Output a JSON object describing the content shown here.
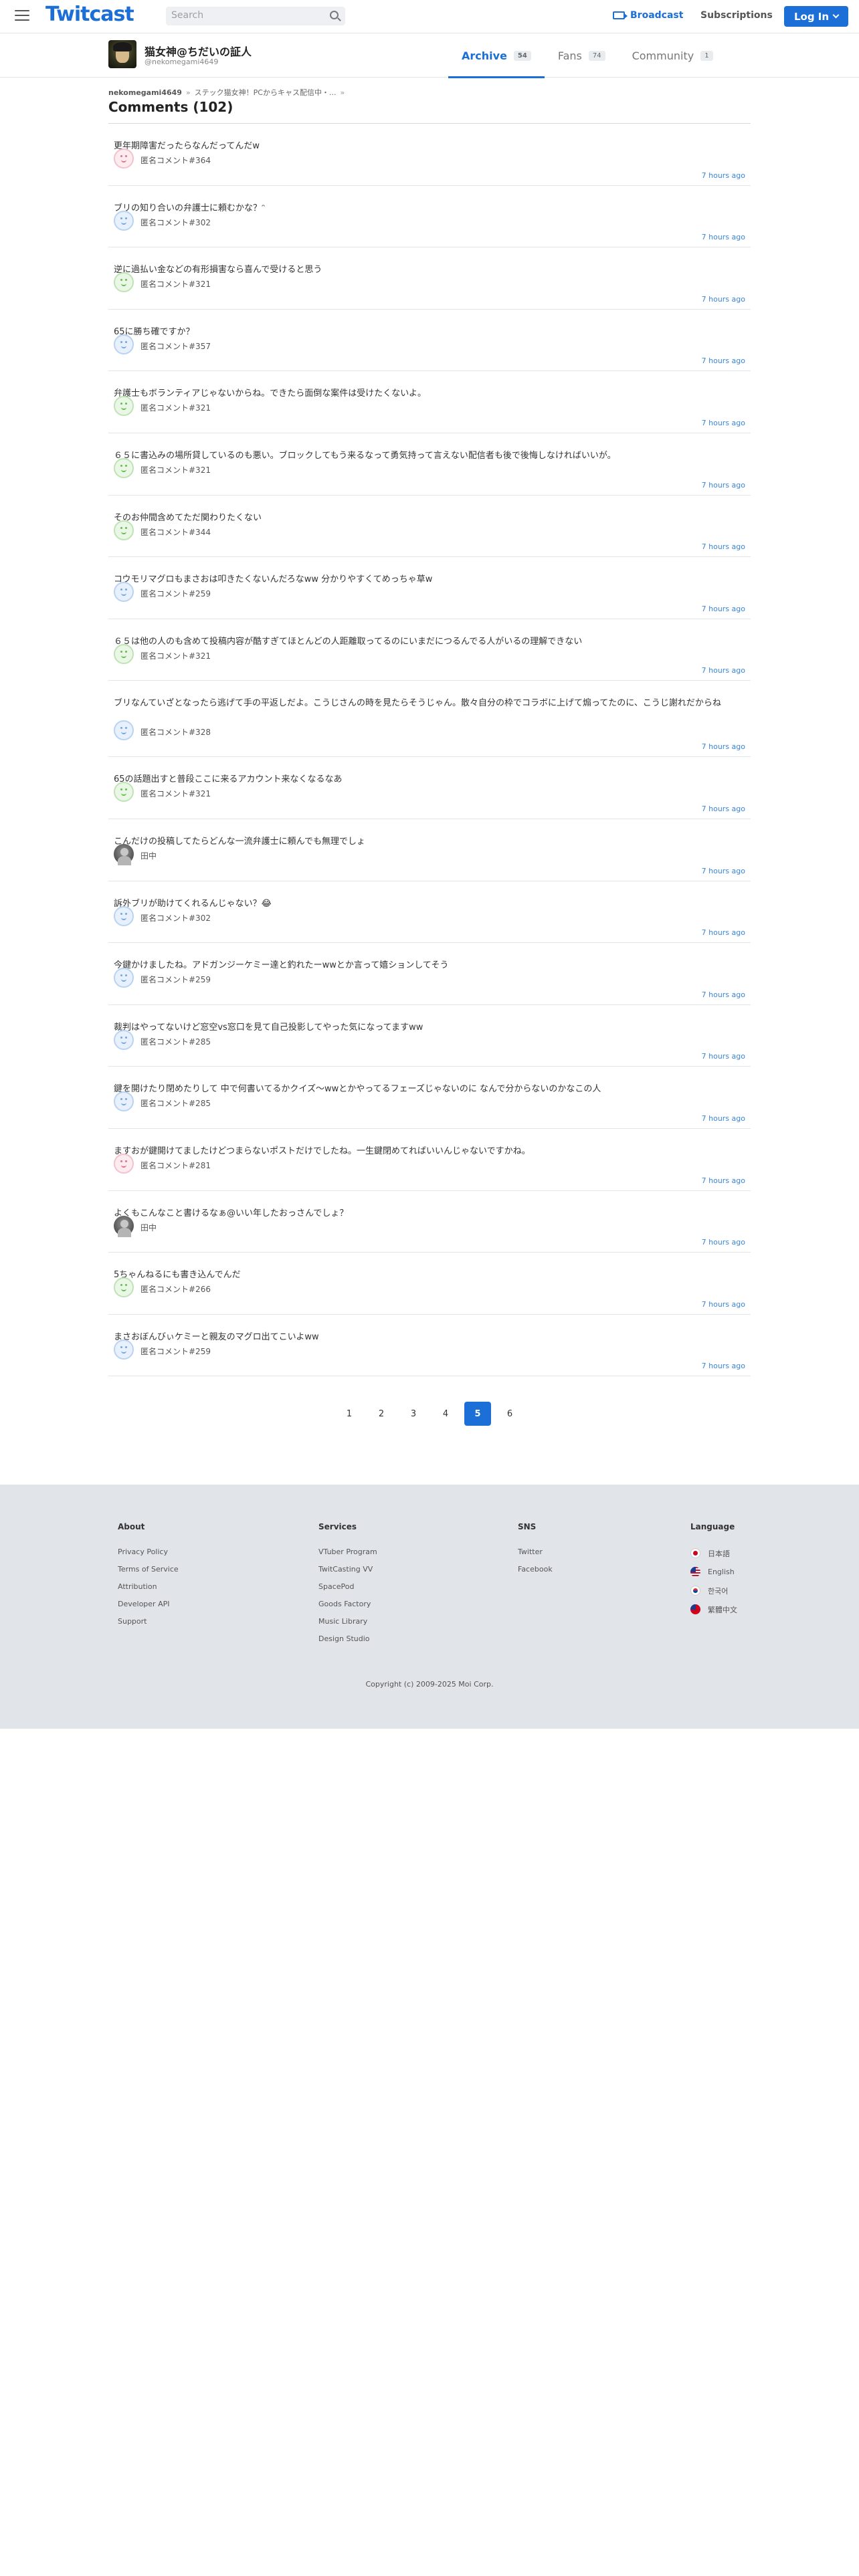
{
  "header": {
    "logo": "Twitcast",
    "search_placeholder": "Search",
    "broadcast_label": "Broadcast",
    "subscriptions_label": "Subscriptions",
    "login_label": "Log In",
    "brand_color": "#1b6fd6"
  },
  "profile": {
    "name": "猫女神@ちだいの証人",
    "handle": "@nekomegami4649",
    "tabs": [
      {
        "label": "Archive",
        "count": "54",
        "active": true
      },
      {
        "label": "Fans",
        "count": "74",
        "active": false
      },
      {
        "label": "Community",
        "count": "1",
        "active": false
      }
    ]
  },
  "breadcrumb": {
    "user": "nekomegami4649",
    "sep": "»",
    "item": "ステック猫女神！PCからキャス配信中・...",
    "tail": "»"
  },
  "page_title": "Comments (102)",
  "comments": [
    {
      "text": "更年期障害だったらなんだってんだw",
      "author": "匿名コメント#364",
      "avatar": "pink",
      "time": "7 hours ago"
    },
    {
      "text": "ブリの知り合いの弁護士に頼むかな？ᵔ",
      "author": "匿名コメント#302",
      "avatar": "blue",
      "time": "7 hours ago"
    },
    {
      "text": "逆に過払い金などの有形損害なら喜んで受けると思う",
      "author": "匿名コメント#321",
      "avatar": "green",
      "time": "7 hours ago"
    },
    {
      "text": "65に勝ち確ですか？",
      "author": "匿名コメント#357",
      "avatar": "blue",
      "time": "7 hours ago"
    },
    {
      "text": "弁護士もボランティアじゃないからね。できたら面倒な案件は受けたくないよ。",
      "author": "匿名コメント#321",
      "avatar": "green",
      "time": "7 hours ago"
    },
    {
      "text": "６５に書込みの場所貸しているのも悪い。ブロックしてもう来るなって勇気持って言えない配信者も後で後悔しなければいいが。",
      "author": "匿名コメント#321",
      "avatar": "green",
      "time": "7 hours ago"
    },
    {
      "text": "そのお仲間含めてただ関わりたくない",
      "author": "匿名コメント#344",
      "avatar": "green",
      "time": "7 hours ago"
    },
    {
      "text": "コウモリマグロもまさおは叩きたくないんだろなww 分かりやすくてめっちゃ草w",
      "author": "匿名コメント#259",
      "avatar": "blue",
      "time": "7 hours ago"
    },
    {
      "text": "６５は他の人のも含めて投稿内容が酷すぎてほとんどの人距離取ってるのにいまだにつるんでる人がいるの理解できない",
      "author": "匿名コメント#321",
      "avatar": "green",
      "time": "7 hours ago"
    },
    {
      "text": "ブリなんていざとなったら逃げて手の平返しだよ。こうじさんの時を見たらそうじゃん。散々自分の枠でコラボに上げて煽ってたのに、こうじ謝れだからね",
      "author": "匿名コメント#328",
      "avatar": "blue",
      "time": "7 hours ago",
      "tall": true
    },
    {
      "text": "65の話題出すと普段ここに来るアカウント来なくなるなあ",
      "author": "匿名コメント#321",
      "avatar": "green",
      "time": "7 hours ago"
    },
    {
      "text": "こんだけの投稿してたらどんな一流弁護士に頼んでも無理でしょ",
      "author": "田中",
      "avatar": "photo",
      "time": "7 hours ago"
    },
    {
      "text": "訴外ブリが助けてくれるんじゃない？😂",
      "author": "匿名コメント#302",
      "avatar": "blue",
      "time": "7 hours ago"
    },
    {
      "text": "今鍵かけましたね。アドガンジーケミー達と釣れたーwwとか言って嬉ションしてそう",
      "author": "匿名コメント#259",
      "avatar": "blue",
      "time": "7 hours ago"
    },
    {
      "text": "裁判はやってないけど窓空vs窓口を見て自己投影してやった気になってますww",
      "author": "匿名コメント#285",
      "avatar": "blue",
      "time": "7 hours ago"
    },
    {
      "text": "鍵を開けたり閉めたりして 中で何書いてるかクイズ〜wwとかやってるフェーズじゃないのに なんで分からないのかなこの人",
      "author": "匿名コメント#285",
      "avatar": "blue",
      "time": "7 hours ago"
    },
    {
      "text": "ますおが鍵開けてましたけどつまらないポストだけでしたね。一生鍵閉めてればいいんじゃないですかね。",
      "author": "匿名コメント#281",
      "avatar": "pink",
      "time": "7 hours ago"
    },
    {
      "text": "よくもこんなこと書けるなぁ@いい年したおっさんでしょ？",
      "author": "田中",
      "avatar": "photo",
      "time": "7 hours ago"
    },
    {
      "text": "5ちゃんねるにも書き込んでんだ",
      "author": "匿名コメント#266",
      "avatar": "green",
      "time": "7 hours ago"
    },
    {
      "text": "まさおぼんびぃケミーと親友のマグロ出てこいよww",
      "author": "匿名コメント#259",
      "avatar": "blue",
      "time": "7 hours ago"
    }
  ],
  "pagination": [
    "1",
    "2",
    "3",
    "4",
    "5",
    "6"
  ],
  "pagination_current": "5",
  "footer": {
    "about": {
      "title": "About",
      "links": [
        "Privacy Policy",
        "Terms of Service",
        "Attribution",
        "Developer API",
        "Support"
      ]
    },
    "services": {
      "title": "Services",
      "links": [
        "VTuber Program",
        "TwitCasting VV",
        "SpacePod",
        "Goods Factory",
        "Music Library",
        "Design Studio"
      ]
    },
    "sns": {
      "title": "SNS",
      "links": [
        "Twitter",
        "Facebook"
      ]
    },
    "language": {
      "title": "Language",
      "links": [
        {
          "label": "日本語",
          "flag": "jp"
        },
        {
          "label": "English",
          "flag": "us"
        },
        {
          "label": "한국어",
          "flag": "kr"
        },
        {
          "label": "繁體中文",
          "flag": "tw"
        }
      ]
    },
    "copyright": "Copyright (c) 2009-2025 Moi Corp."
  }
}
